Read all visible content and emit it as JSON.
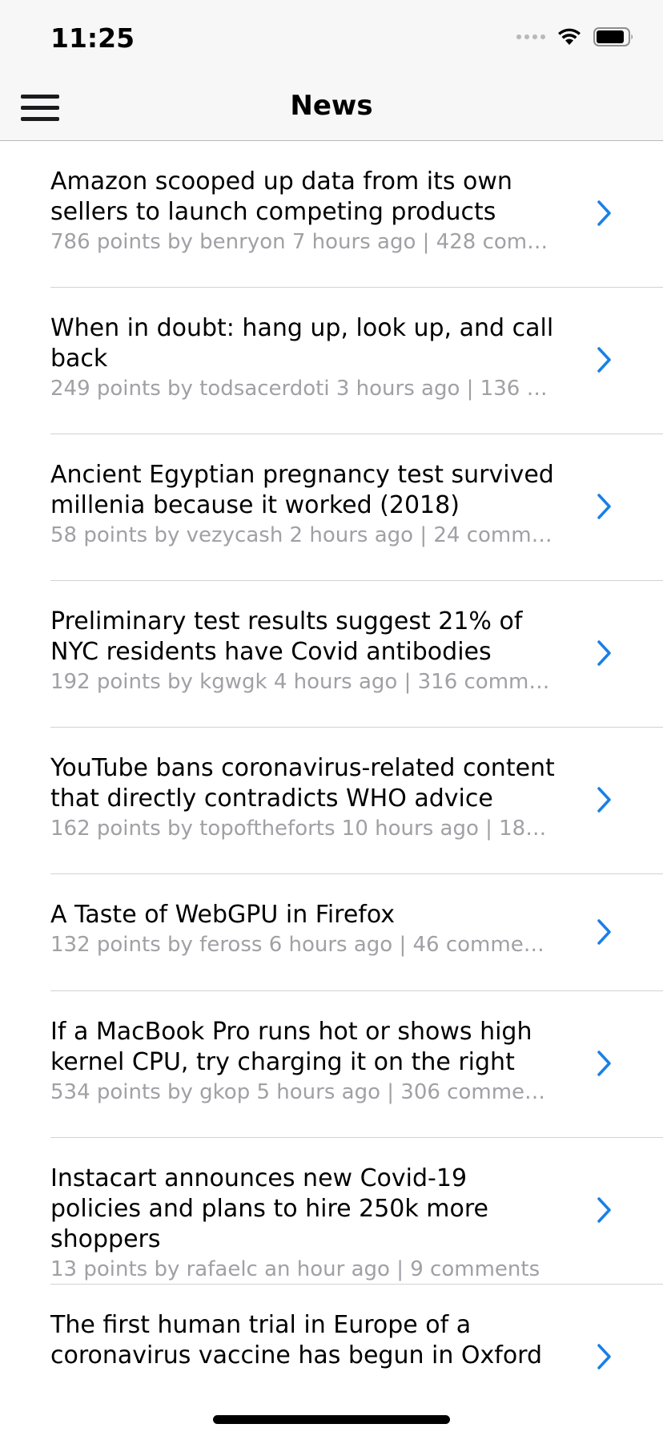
{
  "status_bar": {
    "time": "11:25",
    "icons": [
      "signal-icon",
      "wifi-icon",
      "battery-icon"
    ]
  },
  "nav": {
    "title": "News",
    "menu_icon": "hamburger-menu-icon"
  },
  "colors": {
    "accent": "#1a7fe6",
    "meta_text": "#a0a0a5",
    "bar_background": "#f7f7f7"
  },
  "stories": [
    {
      "title": "Amazon scooped up data from its own sellers to launch competing products",
      "meta": "786 points by benryon 7 hours ago | 428 comme..."
    },
    {
      "title": "When in doubt: hang up, look up, and call back",
      "meta": "249 points by todsacerdoti 3 hours ago | 136 co..."
    },
    {
      "title": "Ancient Egyptian pregnancy test survived millenia because it worked (2018)",
      "meta": "58 points by vezycash 2 hours ago | 24 comments"
    },
    {
      "title": "Preliminary test results suggest 21% of NYC residents have Covid antibodies",
      "meta": "192 points by kgwgk 4 hours ago | 316 comments"
    },
    {
      "title": "YouTube bans coronavirus-related content that directly contradicts WHO advice",
      "meta": "162 points by topoftheforts 10 hours ago | 182 co..."
    },
    {
      "title": "A Taste of WebGPU in Firefox",
      "meta": "132 points by feross 6 hours ago | 46 comments"
    },
    {
      "title": "If a MacBook Pro runs hot or shows high kernel CPU, try charging it on the right",
      "meta": "534 points by gkop 5 hours ago | 306 comments"
    },
    {
      "title": "Instacart announces new Covid-19 policies and plans to hire 250k more shoppers",
      "meta": "13 points by rafaelc an hour ago | 9 comments"
    },
    {
      "title": "The first human trial in Europe of a coronavirus vaccine has begun in Oxford",
      "meta": ""
    }
  ]
}
